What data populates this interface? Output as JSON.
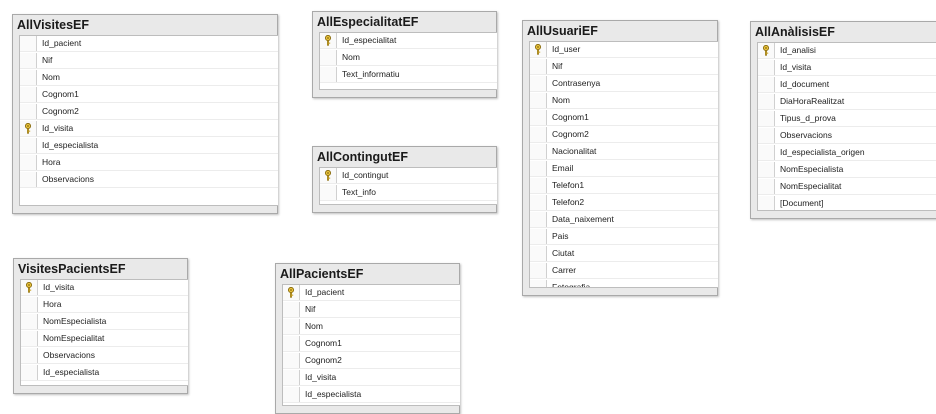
{
  "entities": {
    "allvisites": {
      "title": "AllVisitesEF",
      "fields": [
        {
          "name": "Id_pacient",
          "key": false
        },
        {
          "name": "Nif",
          "key": false
        },
        {
          "name": "Nom",
          "key": false
        },
        {
          "name": "Cognom1",
          "key": false
        },
        {
          "name": "Cognom2",
          "key": false
        },
        {
          "name": "Id_visita",
          "key": true
        },
        {
          "name": "Id_especialista",
          "key": false
        },
        {
          "name": "Hora",
          "key": false
        },
        {
          "name": "Observacions",
          "key": false
        }
      ]
    },
    "allespecialitat": {
      "title": "AllEspecialitatEF",
      "fields": [
        {
          "name": "Id_especialitat",
          "key": true
        },
        {
          "name": "Nom",
          "key": false
        },
        {
          "name": "Text_informatiu",
          "key": false
        }
      ]
    },
    "allcontingut": {
      "title": "AllContingutEF",
      "fields": [
        {
          "name": "Id_contingut",
          "key": true
        },
        {
          "name": "Text_info",
          "key": false
        }
      ]
    },
    "allusuari": {
      "title": "AllUsuariEF",
      "fields": [
        {
          "name": "Id_user",
          "key": true
        },
        {
          "name": "Nif",
          "key": false
        },
        {
          "name": "Contrasenya",
          "key": false
        },
        {
          "name": "Nom",
          "key": false
        },
        {
          "name": "Cognom1",
          "key": false
        },
        {
          "name": "Cognom2",
          "key": false
        },
        {
          "name": "Nacionalitat",
          "key": false
        },
        {
          "name": "Email",
          "key": false
        },
        {
          "name": "Telefon1",
          "key": false
        },
        {
          "name": "Telefon2",
          "key": false
        },
        {
          "name": "Data_naixement",
          "key": false
        },
        {
          "name": "Pais",
          "key": false
        },
        {
          "name": "Ciutat",
          "key": false
        },
        {
          "name": "Carrer",
          "key": false
        },
        {
          "name": "Fotografia",
          "key": false
        }
      ]
    },
    "allanalisis": {
      "title": "AllAnàlisisEF",
      "fields": [
        {
          "name": "Id_analisi",
          "key": true
        },
        {
          "name": "Id_visita",
          "key": false
        },
        {
          "name": "Id_document",
          "key": false
        },
        {
          "name": "DiaHoraRealitzat",
          "key": false
        },
        {
          "name": "Tipus_d_prova",
          "key": false
        },
        {
          "name": "Observacions",
          "key": false
        },
        {
          "name": "Id_especialista_origen",
          "key": false
        },
        {
          "name": "NomEspecialista",
          "key": false
        },
        {
          "name": "NomEspecialitat",
          "key": false
        },
        {
          "name": "[Document]",
          "key": false
        }
      ]
    },
    "visitespacients": {
      "title": "VisitesPacientsEF",
      "fields": [
        {
          "name": "Id_visita",
          "key": true
        },
        {
          "name": "Hora",
          "key": false
        },
        {
          "name": "NomEspecialista",
          "key": false
        },
        {
          "name": "NomEspecialitat",
          "key": false
        },
        {
          "name": "Observacions",
          "key": false
        },
        {
          "name": "Id_especialista",
          "key": false
        }
      ]
    },
    "allpacients": {
      "title": "AllPacientsEF",
      "fields": [
        {
          "name": "Id_pacient",
          "key": true
        },
        {
          "name": "Nif",
          "key": false
        },
        {
          "name": "Nom",
          "key": false
        },
        {
          "name": "Cognom1",
          "key": false
        },
        {
          "name": "Cognom2",
          "key": false
        },
        {
          "name": "Id_visita",
          "key": false
        },
        {
          "name": "Id_especialista",
          "key": false
        }
      ]
    }
  }
}
